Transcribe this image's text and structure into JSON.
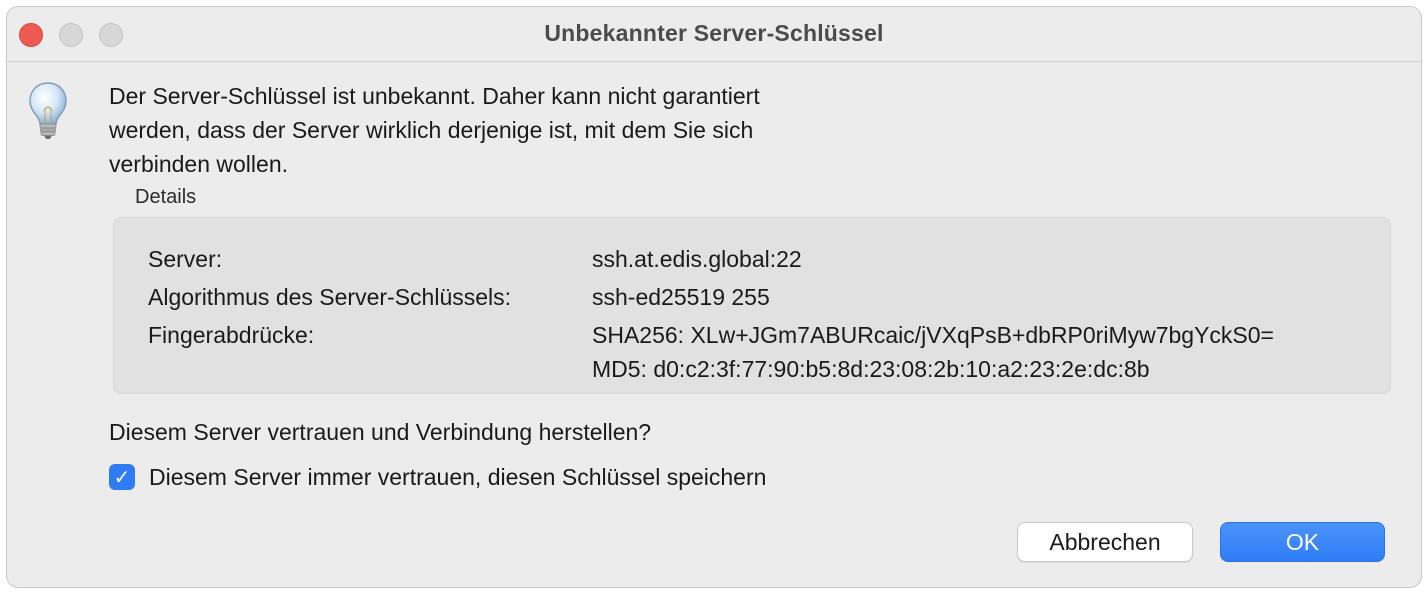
{
  "window": {
    "title": "Unbekannter Server-Schlüssel"
  },
  "icons": {
    "message_icon": "lightbulb-icon",
    "checkbox_glyph": "✓"
  },
  "message": {
    "lines": [
      "Der Server-Schlüssel ist unbekannt. Daher kann nicht garantiert",
      "werden, dass der Server wirklich derjenige ist, mit dem Sie sich",
      "verbinden wollen."
    ]
  },
  "details": {
    "label": "Details",
    "server_label": "Server:",
    "server_value": "ssh.at.edis.global:22",
    "algorithm_label": "Algorithmus des Server-Schlüssels:",
    "algorithm_value": "ssh-ed25519 255",
    "fingerprints_label": "Fingerabdrücke:",
    "fingerprint_sha256": "SHA256: XLw+JGm7ABURcaic/jVXqPsB+dbRP0riMyw7bgYckS0=",
    "fingerprint_md5": "MD5: d0:c2:3f:77:90:b5:8d:23:08:2b:10:a2:23:2e:dc:8b"
  },
  "question": "Diesem Server vertrauen und Verbindung herstellen?",
  "trust_checkbox": {
    "label": "Diesem Server immer vertrauen, diesen Schlüssel speichern",
    "checked": true
  },
  "buttons": {
    "cancel": "Abbrechen",
    "ok": "OK"
  },
  "colors": {
    "accent": "#2f7cf6",
    "close": "#ee5a52",
    "window_bg": "#ececec",
    "details_bg": "#e1e1e1"
  }
}
